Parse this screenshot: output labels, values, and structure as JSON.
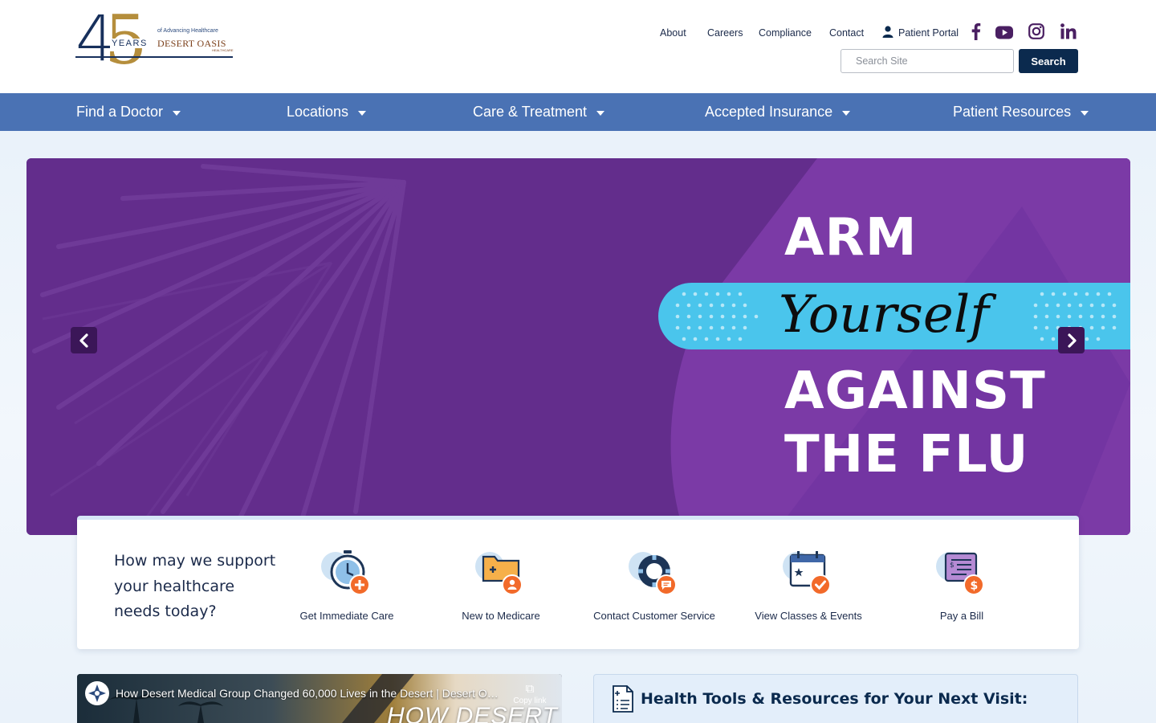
{
  "brand": {
    "logo_years": "YEARS",
    "logo_tagline": "of Advancing Healthcare",
    "logo_name": "DESERT OASIS",
    "logo_sub": "HEALTHCARE",
    "logo_digit_4": "4",
    "logo_digit_5": "5"
  },
  "utility_nav": {
    "about": "About",
    "careers": "Careers",
    "compliance": "Compliance",
    "contact": "Contact",
    "patient_portal": "Patient Portal"
  },
  "social": [
    "facebook-icon",
    "youtube-icon",
    "instagram-icon",
    "linkedin-icon"
  ],
  "search": {
    "placeholder": "Search Site",
    "button_label": "Search"
  },
  "main_nav": [
    {
      "label": "Find a Doctor"
    },
    {
      "label": "Locations"
    },
    {
      "label": "Care & Treatment"
    },
    {
      "label": "Accepted Insurance"
    },
    {
      "label": "Patient Resources"
    }
  ],
  "hero": {
    "line1": "ARM",
    "line2": "Yourself",
    "line3": "AGAINST",
    "line4": "THE FLU"
  },
  "support": {
    "question": "How may we support your healthcare needs today?",
    "actions": [
      {
        "label": "Get Immediate Care",
        "icon": "stopwatch-plus-icon"
      },
      {
        "label": "New to Medicare",
        "icon": "folder-person-icon"
      },
      {
        "label": "Contact Customer Service",
        "icon": "lifebuoy-chat-icon"
      },
      {
        "label": "View Classes & Events",
        "icon": "calendar-check-icon"
      },
      {
        "label": "Pay a Bill",
        "icon": "bill-dollar-icon"
      }
    ]
  },
  "video": {
    "title": "How Desert Medical Group Changed 60,000 Lives in the Desert | Desert Oasi...",
    "copy_link": "Copy link",
    "overlay_text": "HOW DESERT"
  },
  "tools": {
    "heading": "Health Tools & Resources for Your Next Visit:"
  },
  "colors": {
    "nav_blue": "#4a72b4",
    "navy": "#0b2a4e",
    "hero_purple": "#632d8c",
    "hero_band": "#4ac5ec",
    "accent_orange": "#f26a2a",
    "gold": "#b58e3c"
  }
}
